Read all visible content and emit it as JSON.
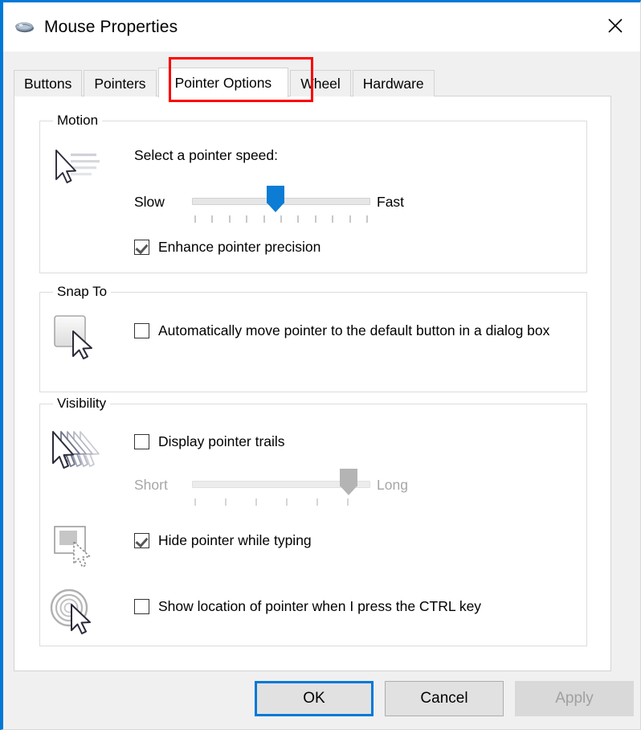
{
  "window": {
    "title": "Mouse Properties",
    "icon": "mouse-icon",
    "close_icon": "close-icon",
    "accent_color": "#0078d7"
  },
  "tabs": [
    {
      "label": "Buttons",
      "active": false
    },
    {
      "label": "Pointers",
      "active": false
    },
    {
      "label": "Pointer Options",
      "active": true
    },
    {
      "label": "Wheel",
      "active": false
    },
    {
      "label": "Hardware",
      "active": false
    }
  ],
  "highlight": {
    "color": "#ff0000",
    "target": "Pointer Options"
  },
  "groups": {
    "motion": {
      "legend": "Motion",
      "icon": "pointer-speed-icon",
      "speed_label": "Select a pointer speed:",
      "slider": {
        "min_label": "Slow",
        "max_label": "Fast",
        "ticks": 11,
        "value": 6,
        "enabled": true,
        "thumb_color": "#0c7cd5",
        "track_color": "#e6e6e6"
      },
      "checkbox": {
        "label": "Enhance pointer precision",
        "checked": true
      }
    },
    "snap_to": {
      "legend": "Snap To",
      "icon": "default-button-cursor-icon",
      "checkbox": {
        "label": "Automatically move pointer to the default button in a dialog box",
        "checked": false
      }
    },
    "visibility": {
      "legend": "Visibility",
      "trails": {
        "icon": "pointer-trails-icon",
        "checkbox": {
          "label": "Display pointer trails",
          "checked": false
        },
        "slider": {
          "min_label": "Short",
          "max_label": "Long",
          "ticks": 6,
          "value": 6,
          "enabled": false,
          "thumb_color": "#b4b4b4",
          "track_color": "#ececec"
        }
      },
      "hide_typing": {
        "icon": "hide-pointer-typing-icon",
        "checkbox": {
          "label": "Hide pointer while typing",
          "checked": true
        }
      },
      "show_location": {
        "icon": "pointer-location-ctrl-icon",
        "checkbox": {
          "label": "Show location of pointer when I press the CTRL key",
          "checked": false
        }
      }
    }
  },
  "footer": {
    "ok": "OK",
    "cancel": "Cancel",
    "apply": "Apply",
    "apply_disabled": true,
    "default_button": "OK"
  }
}
